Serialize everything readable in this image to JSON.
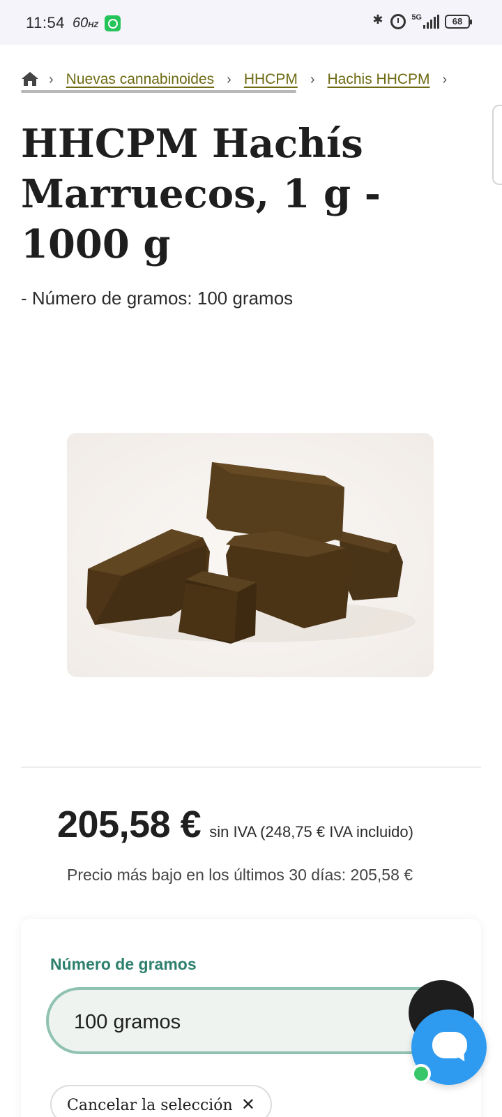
{
  "status_bar": {
    "time": "11:54",
    "refresh_rate": "60",
    "refresh_unit": "HZ",
    "network": "5G",
    "battery": "68"
  },
  "breadcrumb": {
    "items": [
      "Nuevas cannabinoides",
      "HHCPM",
      "Hachis HHCPM"
    ],
    "separator": "›"
  },
  "product": {
    "title": "HHCPM Hachís Marruecos, 1 g - 1000 g",
    "subtitle": "- Número de gramos: 100 gramos"
  },
  "price": {
    "main": "205,58 €",
    "tax_note": "sin IVA (248,75 € IVA incluido)",
    "lowest_note": "Precio más bajo en los últimos 30 días: 205,58 €"
  },
  "options": {
    "label": "Número de gramos",
    "selected_value": "100 gramos",
    "cancel_label": "Cancelar la selección"
  },
  "colors": {
    "breadcrumb_link": "#6d6a12",
    "option_label": "#2d7f6e",
    "select_border": "#8fc2b1",
    "chat_button": "#2f9bf0",
    "online_dot": "#38c66a"
  }
}
